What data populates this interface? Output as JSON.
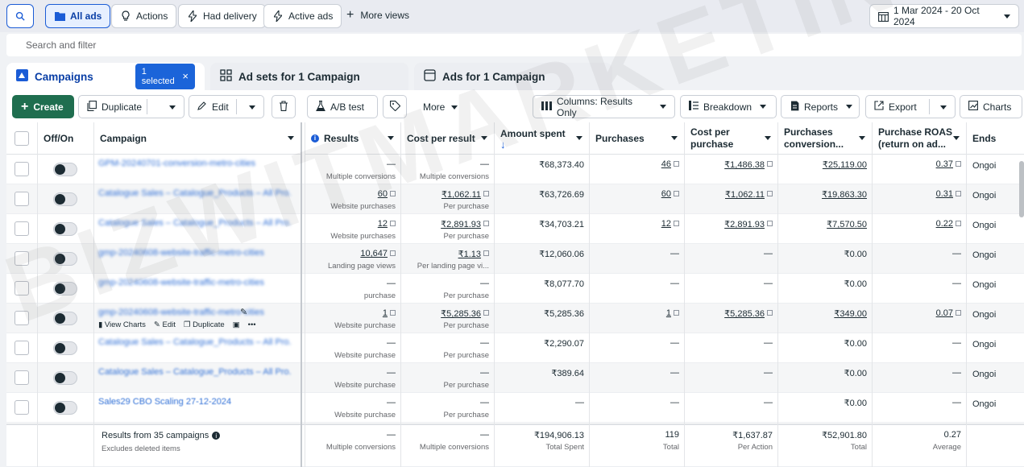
{
  "topbar": {
    "views": [
      {
        "label": "All ads",
        "icon": "folder-icon",
        "active": true
      },
      {
        "label": "Actions",
        "icon": "lightbulb-icon"
      },
      {
        "label": "Had delivery",
        "icon": "bolt-icon"
      },
      {
        "label": "Active ads",
        "icon": "bolt-icon"
      }
    ],
    "more_views": "More views",
    "date_range": "1 Mar 2024 - 20 Oct 2024"
  },
  "search": {
    "placeholder": "Search and filter"
  },
  "tabs": {
    "campaigns": "Campaigns",
    "selected": "1 selected",
    "adsets": "Ad sets for 1 Campaign",
    "ads": "Ads for 1 Campaign"
  },
  "toolbar": {
    "create": "Create",
    "duplicate": "Duplicate",
    "edit": "Edit",
    "ab_test": "A/B test",
    "more": "More",
    "columns": "Columns: Results Only",
    "breakdown": "Breakdown",
    "reports": "Reports",
    "export": "Export",
    "charts": "Charts"
  },
  "columns": {
    "offon": "Off/On",
    "campaign": "Campaign",
    "results": "Results",
    "cost_per_result": "Cost per result",
    "amount_spent": "Amount spent",
    "purchases": "Purchases",
    "cost_per_purchase_1": "Cost per",
    "cost_per_purchase_2": "purchase",
    "purchases_conv_1": "Purchases",
    "purchases_conv_2": "conversion...",
    "roas_1": "Purchase ROAS",
    "roas_2": "(return on ad...",
    "ends": "Ends"
  },
  "row_actions": {
    "view_charts": "View Charts",
    "edit": "Edit",
    "duplicate": "Duplicate",
    "more": "•••"
  },
  "rows": [
    {
      "name": "GPM-20240701-conversion-metro-cities",
      "results": "—",
      "results_sub": "Multiple conversions",
      "cpr": "—",
      "cpr_sub": "Multiple conversions",
      "spent": "₹68,373.40",
      "purchases": "46",
      "cpp": "₹1,486.38",
      "conv": "₹25,119.00",
      "roas": "0.37",
      "ends": "Ongoi"
    },
    {
      "name": "Catalogue Sales – Catalogue_Products – All Pro...",
      "results": "60",
      "results_sub": "Website purchases",
      "cpr": "₹1,062.11",
      "cpr_sub": "Per purchase",
      "spent": "₹63,726.69",
      "purchases": "60",
      "cpp": "₹1,062.11",
      "conv": "₹19,863.30",
      "roas": "0.31",
      "ends": "Ongoi"
    },
    {
      "name": "Catalogue Sales – Catalogue_Products – All Pro...",
      "results": "12",
      "results_sub": "Website purchases",
      "cpr": "₹2,891.93",
      "cpr_sub": "Per purchase",
      "spent": "₹34,703.21",
      "purchases": "12",
      "cpp": "₹2,891.93",
      "conv": "₹7,570.50",
      "roas": "0.22",
      "ends": "Ongoi"
    },
    {
      "name": "gmp-20240608-website-traffic-metro-cities",
      "results": "10,647",
      "results_sub": "Landing page views",
      "cpr": "₹1.13",
      "cpr_sub": "Per landing page vi...",
      "spent": "₹12,060.06",
      "purchases": "—",
      "cpp": "—",
      "conv": "₹0.00",
      "roas": "—",
      "ends": "Ongoi"
    },
    {
      "name": "gmp-20240608-website-traffic-metro-cities",
      "results": "—",
      "results_sub": "purchase",
      "cpr": "—",
      "cpr_sub": "Per purchase",
      "spent": "₹8,077.70",
      "purchases": "—",
      "cpp": "—",
      "conv": "₹0.00",
      "roas": "—",
      "ends": "Ongoi"
    },
    {
      "name": "gmp-20240608-website-traffic-metro-cities",
      "results": "1",
      "results_sub": "Website purchase",
      "cpr": "₹5,285.36",
      "cpr_sub": "Per purchase",
      "spent": "₹5,285.36",
      "purchases": "1",
      "cpp": "₹5,285.36",
      "conv": "₹349.00",
      "roas": "0.07",
      "ends": "Ongoi"
    },
    {
      "name": "Catalogue Sales – Catalogue_Products – All Pro...",
      "results": "—",
      "results_sub": "Website purchase",
      "cpr": "—",
      "cpr_sub": "Per purchase",
      "spent": "₹2,290.07",
      "purchases": "—",
      "cpp": "—",
      "conv": "₹0.00",
      "roas": "—",
      "ends": "Ongoi"
    },
    {
      "name": "Catalogue Sales – Catalogue_Products – All Pro...",
      "results": "—",
      "results_sub": "Website purchase",
      "cpr": "—",
      "cpr_sub": "Per purchase",
      "spent": "₹389.64",
      "purchases": "—",
      "cpp": "—",
      "conv": "₹0.00",
      "roas": "—",
      "ends": "Ongoi"
    },
    {
      "name": "Sales29 CBO Scaling 27-12-2024",
      "results": "—",
      "results_sub": "Website purchase",
      "cpr": "—",
      "cpr_sub": "Per purchase",
      "spent": "—",
      "purchases": "—",
      "cpp": "—",
      "conv": "₹0.00",
      "roas": "—",
      "ends": "Ongoi"
    }
  ],
  "footer": {
    "title": "Results from 35 campaigns",
    "subtitle": "Excludes deleted items",
    "results": "—",
    "results_sub": "Multiple conversions",
    "cpr": "—",
    "cpr_sub": "Multiple conversions",
    "spent": "₹194,906.13",
    "spent_sub": "Total Spent",
    "purchases": "119",
    "purchases_sub": "Total",
    "cpp": "₹1,637.87",
    "cpp_sub": "Per Action",
    "conv": "₹52,901.80",
    "conv_sub": "Total",
    "roas": "0.27",
    "roas_sub": "Average"
  },
  "watermark": "BIZWITMARKETING"
}
